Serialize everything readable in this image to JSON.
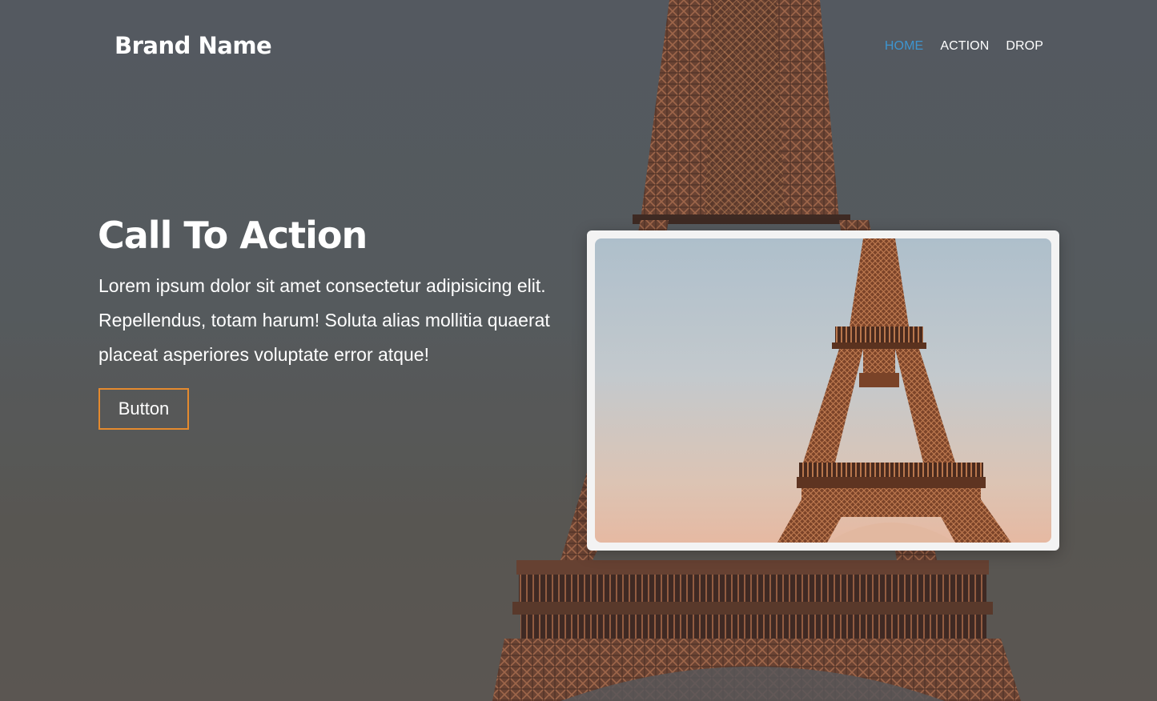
{
  "navbar": {
    "brand": "Brand Name",
    "links": [
      {
        "label": "HOME",
        "active": true
      },
      {
        "label": "ACTION",
        "active": false
      },
      {
        "label": "DROP",
        "active": false
      }
    ]
  },
  "hero": {
    "title": "Call To Action",
    "text": "Lorem ipsum dolor sit amet consectetur adipisicing elit. Repellendus, totam harum! Soluta alias mollitia quaerat placeat asperiores voluptate error atque!",
    "button_label": "Button"
  },
  "colors": {
    "accent": "#e58a2e",
    "active_link": "#3d95d0",
    "text": "#ffffff"
  }
}
